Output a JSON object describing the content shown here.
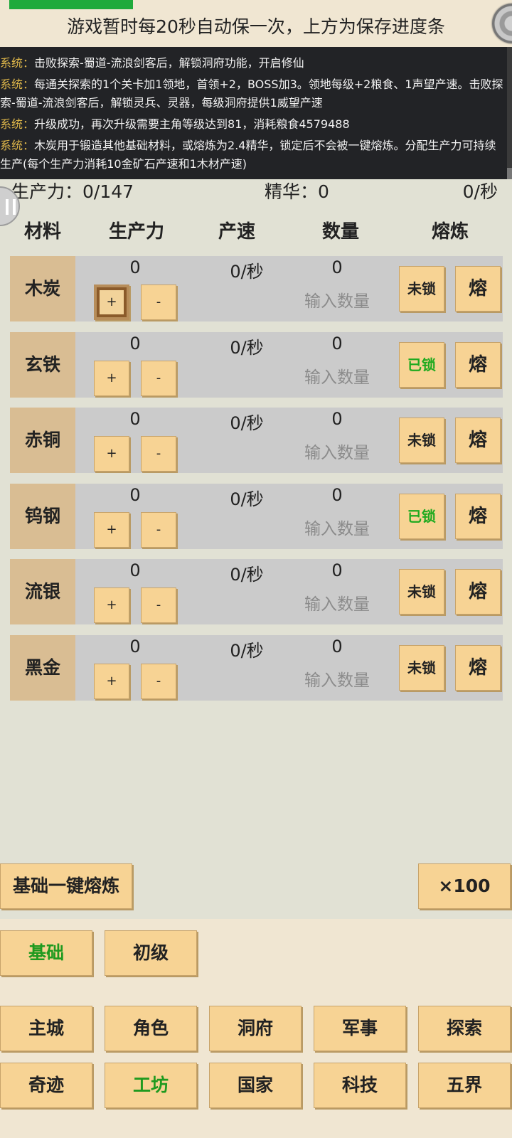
{
  "save_notice": "游戏暂时每20秒自动保一次，上方为保存进度条",
  "log": [
    {
      "prefix": "系统：",
      "text": "击败探索-蜀道-流浪剑客后，解锁洞府功能，开启修仙"
    },
    {
      "prefix": "系统：",
      "text": "每通关探索的1个关卡加1领地，首领+2，BOSS加3。领地每级+2粮食、1声望产速。击败探索-蜀道-流浪剑客后，解锁灵兵、灵器，每级洞府提供1威望产速"
    },
    {
      "prefix": "系统：",
      "text": "升级成功，再次升级需要主角等级达到81，消耗粮食4579488"
    },
    {
      "prefix": "系统：",
      "text": "木炭用于锻造其他基础材料，或熔炼为2.4精华，锁定后不会被一键熔炼。分配生产力可持续生产(每个生产力消耗10金矿石产速和1木材产速)"
    }
  ],
  "summary": {
    "productivity": "生产力：0/147",
    "essence": "精华：0",
    "rate": "0/秒"
  },
  "headers": {
    "material": "材料",
    "productivity": "生产力",
    "rate": "产速",
    "quantity": "数量",
    "smelt": "熔炼"
  },
  "rows": [
    {
      "name": "木炭",
      "productivity": "0",
      "rate": "0/秒",
      "quantity": "0",
      "placeholder": "输入数量",
      "plus": "+",
      "minus": "-",
      "lock": "未锁",
      "locked": false,
      "smelt": "熔"
    },
    {
      "name": "玄铁",
      "productivity": "0",
      "rate": "0/秒",
      "quantity": "0",
      "placeholder": "输入数量",
      "plus": "+",
      "minus": "-",
      "lock": "已锁",
      "locked": true,
      "smelt": "熔"
    },
    {
      "name": "赤铜",
      "productivity": "0",
      "rate": "0/秒",
      "quantity": "0",
      "placeholder": "输入数量",
      "plus": "+",
      "minus": "-",
      "lock": "未锁",
      "locked": false,
      "smelt": "熔"
    },
    {
      "name": "钨钢",
      "productivity": "0",
      "rate": "0/秒",
      "quantity": "0",
      "placeholder": "输入数量",
      "plus": "+",
      "minus": "-",
      "lock": "已锁",
      "locked": true,
      "smelt": "熔"
    },
    {
      "name": "流银",
      "productivity": "0",
      "rate": "0/秒",
      "quantity": "0",
      "placeholder": "输入数量",
      "plus": "+",
      "minus": "-",
      "lock": "未锁",
      "locked": false,
      "smelt": "熔"
    },
    {
      "name": "黑金",
      "productivity": "0",
      "rate": "0/秒",
      "quantity": "0",
      "placeholder": "输入数量",
      "plus": "+",
      "minus": "-",
      "lock": "未锁",
      "locked": false,
      "smelt": "熔"
    }
  ],
  "actions": {
    "smelt_all": "基础一键熔炼",
    "multiplier": "×100"
  },
  "tier_tabs": [
    "基础",
    "初级"
  ],
  "nav": [
    "主城",
    "角色",
    "洞府",
    "军事",
    "探索",
    "奇迹",
    "工坊",
    "国家",
    "科技",
    "五界"
  ],
  "colors": {
    "accent_green": "#1f9a1f",
    "button": "#f7d394",
    "material_cell": "#d9bd93",
    "save_bar": "#1faa3c"
  },
  "icons": {
    "corner": "settings-disc-icon",
    "float": "pause-icon"
  }
}
